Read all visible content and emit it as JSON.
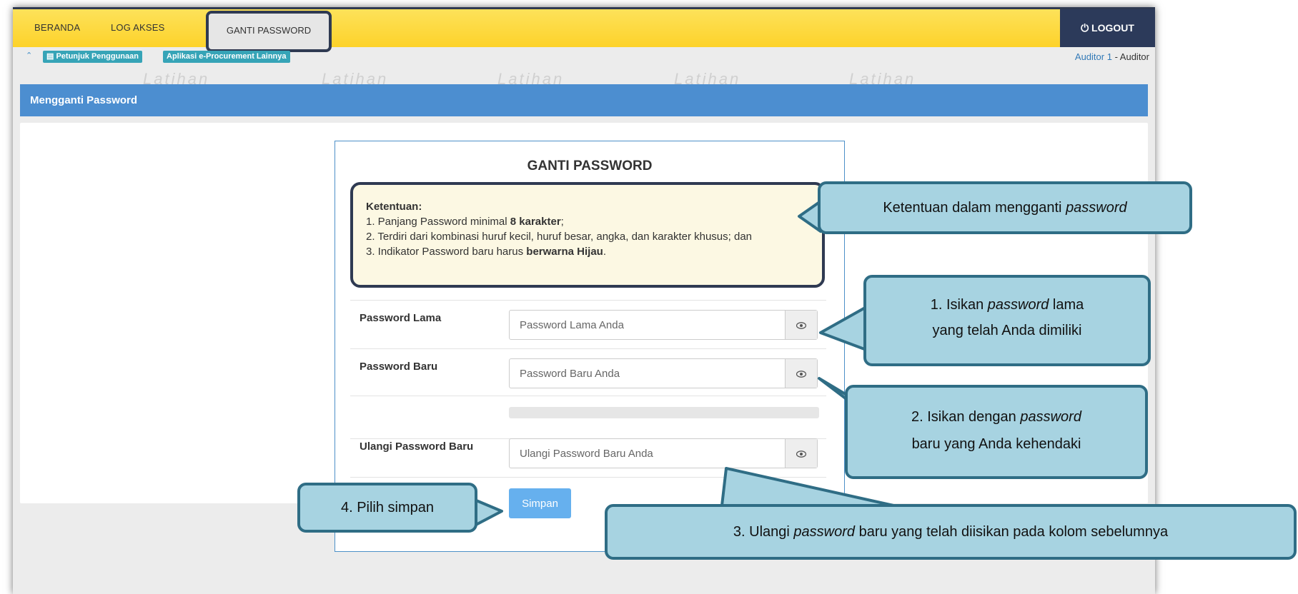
{
  "nav": {
    "beranda": "BERANDA",
    "log_akses": "LOG AKSES",
    "ganti_password": "GANTI PASSWORD",
    "logout": "LOGOUT"
  },
  "subbar": {
    "petunjuk": "Petunjuk Penggunaan",
    "aplikasi": "Aplikasi e-Procurement Lainnya",
    "user_name": "Auditor 1",
    "user_sep": " - ",
    "user_role": "Auditor"
  },
  "watermark_text": "Latihan",
  "page": {
    "header": "Mengganti Password",
    "card_title": "GANTI PASSWORD"
  },
  "ketentuan": {
    "title": "Ketentuan:",
    "item1_pre": "1. Panjang Password minimal ",
    "item1_bold": "8 karakter",
    "item1_post": ";",
    "item2": "2. Terdiri dari kombinasi huruf kecil, huruf besar, angka, dan karakter khusus; dan",
    "item3_pre": "3. Indikator Password baru harus ",
    "item3_bold": "berwarna Hijau",
    "item3_post": "."
  },
  "form": {
    "old_label": "Password Lama",
    "old_placeholder": "Password Lama Anda",
    "new_label": "Password Baru",
    "new_placeholder": "Password Baru Anda",
    "repeat_label": "Ulangi Password Baru",
    "repeat_placeholder": "Ulangi Password Baru Anda",
    "save_button": "Simpan"
  },
  "callouts": {
    "ketentuan_pre": "Ketentuan dalam mengganti ",
    "ketentuan_it": "password",
    "c1_a": "1. Isikan ",
    "c1_it": "password",
    "c1_b": " lama",
    "c1_line2": "yang telah Anda dimiliki",
    "c2_a": "2. Isikan dengan ",
    "c2_it": "password",
    "c2_line2": "baru yang Anda kehendaki",
    "c3_a": "3. Ulangi ",
    "c3_it": "password",
    "c3_b": " baru yang telah diisikan pada kolom sebelumnya",
    "c4": "4. Pilih simpan"
  },
  "colors": {
    "topbar": "#fdd22a",
    "logout_bg": "#2c3a5a",
    "header_blue": "#4c8ed0",
    "callout_fill": "#a7d3e1",
    "callout_border": "#2f6d85",
    "save_button": "#66b0ee"
  }
}
